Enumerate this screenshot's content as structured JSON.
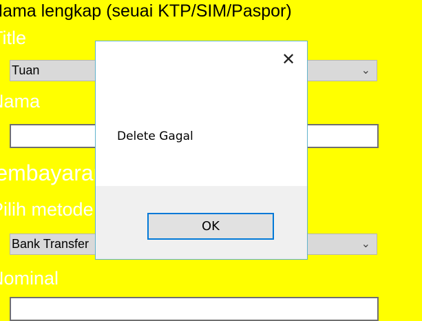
{
  "form": {
    "section_title": "Nama lengkap (seuai KTP/SIM/Paspor)",
    "title_label": "Title",
    "title_value": "Tuan",
    "nama_label": "Nama",
    "payment_heading": "Pembayaran :",
    "method_label": "Pilih metode",
    "method_value": "Bank Transfer",
    "nominal_label": "Nominal"
  },
  "icons": {
    "dropdown": "chevron-down-icon",
    "close": "close-icon"
  },
  "dialog": {
    "message": "Delete Gagal",
    "ok_label": "OK"
  },
  "colors": {
    "page_background": "#ffff00",
    "accent": "#0078d7",
    "dialog_border": "#5fb2cc"
  }
}
